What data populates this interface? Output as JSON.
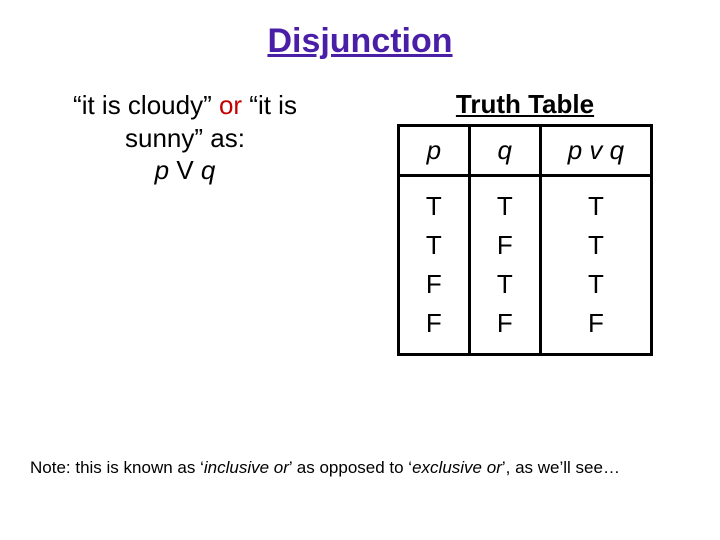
{
  "title": "Disjunction",
  "left": {
    "line1a": "“it is cloudy” ",
    "line1_or": "or",
    "line1b": " “it is",
    "line2": "sunny” as:",
    "line3a": "p",
    "line3b": " V ",
    "line3c": "q"
  },
  "truth_table": {
    "title": "Truth Table",
    "headers": {
      "p": "p",
      "q": "q",
      "pvq": "p v q"
    },
    "rows": [
      {
        "p": "T",
        "q": "T",
        "pvq": "T"
      },
      {
        "p": "T",
        "q": "F",
        "pvq": "T"
      },
      {
        "p": "F",
        "q": "T",
        "pvq": "T"
      },
      {
        "p": "F",
        "q": "F",
        "pvq": "F"
      }
    ]
  },
  "note": {
    "a": "Note: this is known as ‘",
    "inc": "inclusive or",
    "b": "’ as opposed to ‘",
    "exc": "exclusive or",
    "c": "’, as we’ll see…"
  },
  "chart_data": {
    "type": "table",
    "title": "Truth Table",
    "columns": [
      "p",
      "q",
      "p v q"
    ],
    "rows": [
      [
        "T",
        "T",
        "T"
      ],
      [
        "T",
        "F",
        "T"
      ],
      [
        "F",
        "T",
        "T"
      ],
      [
        "F",
        "F",
        "F"
      ]
    ]
  }
}
